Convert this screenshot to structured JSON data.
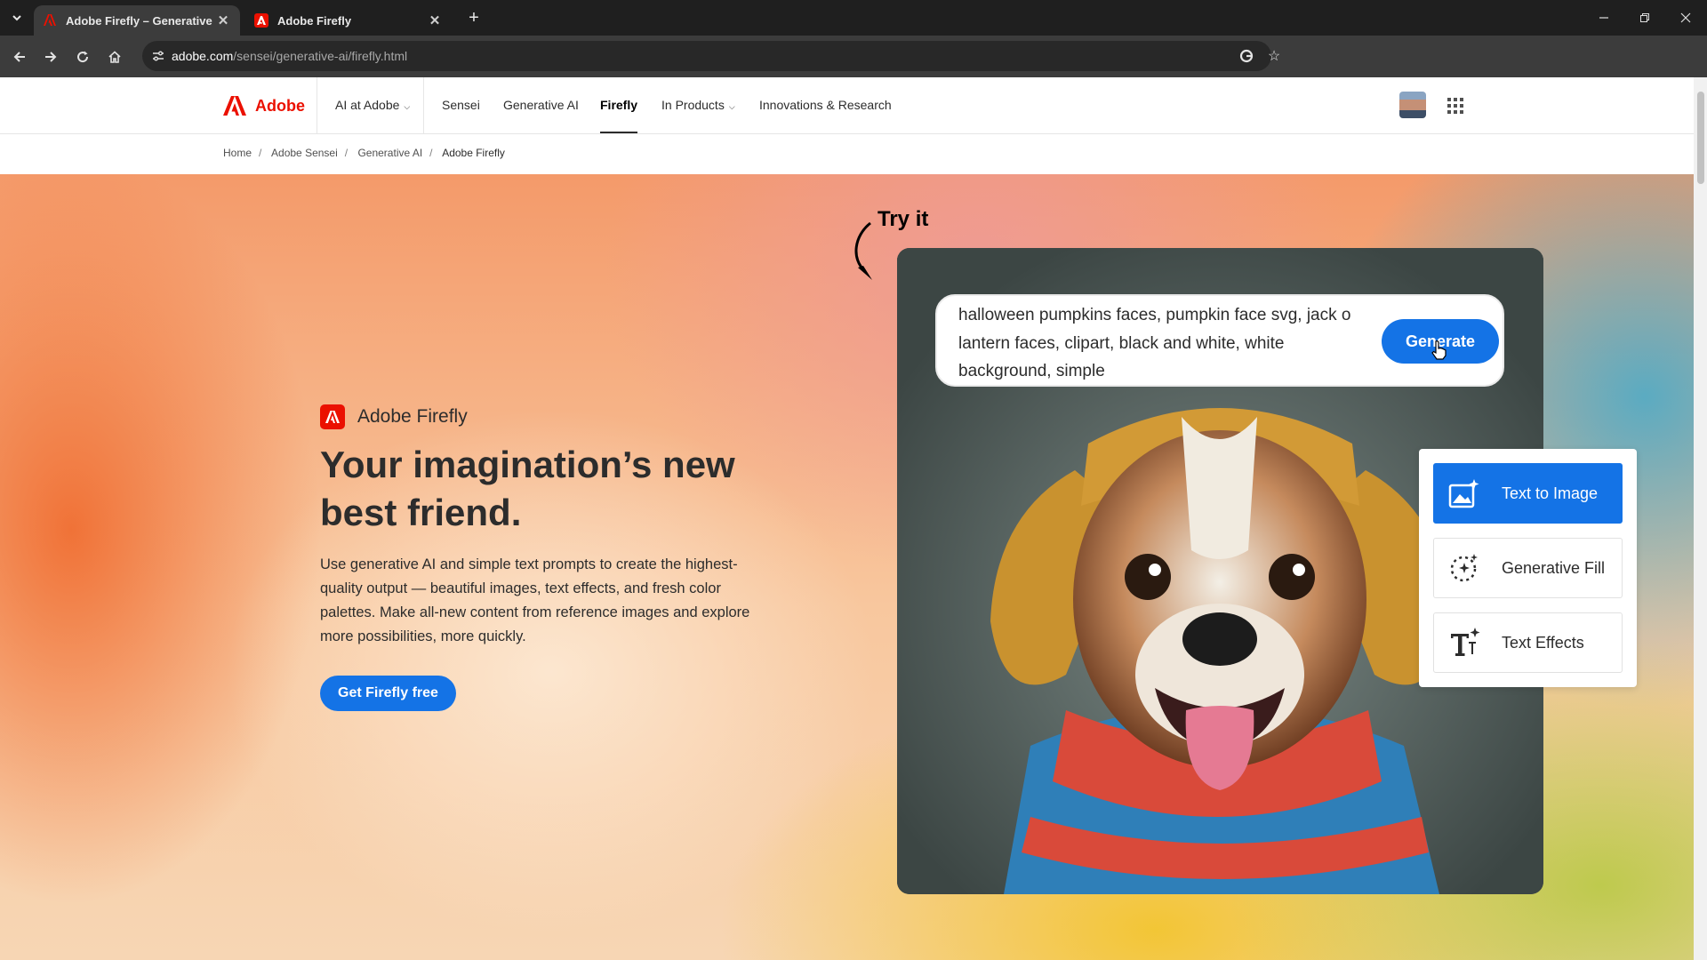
{
  "browser": {
    "tabs": [
      {
        "title": "Adobe Firefly – Generative AI f",
        "active": true
      },
      {
        "title": "Adobe Firefly",
        "active": false
      }
    ],
    "url_host": "adobe.com",
    "url_path": "/sensei/generative-ai/firefly.html"
  },
  "nav": {
    "brand": "Adobe",
    "items": [
      {
        "label": "AI at Adobe",
        "has_menu": true
      },
      {
        "label": "Sensei"
      },
      {
        "label": "Generative AI"
      },
      {
        "label": "Firefly",
        "active": true
      },
      {
        "label": "In Products",
        "has_menu": true
      },
      {
        "label": "Innovations & Research"
      }
    ]
  },
  "breadcrumb": [
    "Home",
    "Adobe Sensei",
    "Generative AI",
    "Adobe Firefly"
  ],
  "hero": {
    "product_name": "Adobe Firefly",
    "title": "Your imagination’s new best friend.",
    "body": "Use generative AI and simple text prompts to create the highest-quality output — beautiful images, text effects, and fresh color palettes. Make all-new content from reference images and explore more possibilities, more quickly.",
    "cta_label": "Get Firefly free"
  },
  "demo": {
    "try_it_label": "Try it",
    "prompt_text": "halloween pumpkins faces, pumpkin face svg, jack o lantern faces, clipart, black and white, white background, simple",
    "generate_label": "Generate",
    "features": [
      {
        "label": "Text to Image",
        "icon": "text-to-image-icon",
        "selected": true
      },
      {
        "label": "Generative Fill",
        "icon": "generative-fill-icon",
        "selected": false
      },
      {
        "label": "Text Effects",
        "icon": "text-effects-icon",
        "selected": false
      }
    ]
  },
  "colors": {
    "adobe_red": "#eb1000",
    "accent_blue": "#1473e6",
    "chrome_dark": "#1f1f1f"
  }
}
